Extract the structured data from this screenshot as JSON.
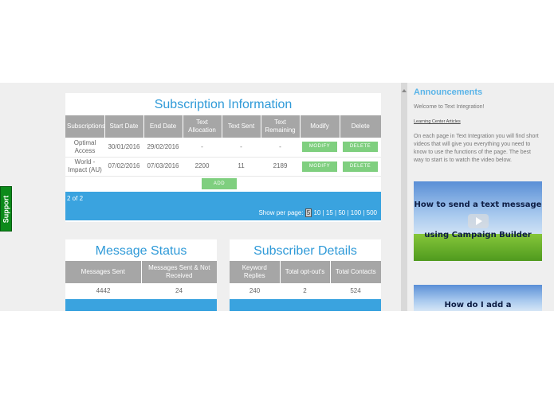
{
  "support_tab": {
    "label": "Support"
  },
  "subscription": {
    "title": "Subscription Information",
    "columns": [
      "Subscriptions",
      "Start Date",
      "End Date",
      "Text Allocation",
      "Text Sent",
      "Text Remaining",
      "Modify",
      "Delete"
    ],
    "rows": [
      {
        "name": "Optimal Access",
        "start": "30/01/2016",
        "end": "29/02/2016",
        "allocation": "-",
        "sent": "-",
        "remaining": "-",
        "modify": "MODIFY",
        "delete": "DELETE"
      },
      {
        "name": "World - Impact (AU)",
        "start": "07/02/2016",
        "end": "07/03/2016",
        "allocation": "2200",
        "sent": "11",
        "remaining": "2189",
        "modify": "MODIFY",
        "delete": "DELETE"
      }
    ],
    "add_label": "ADD",
    "pager_text": "2 of 2",
    "show_per_page_label": "Show per page:",
    "page_sizes": [
      "5",
      "10",
      "15",
      "50",
      "100",
      "500"
    ],
    "selected_page_size": "5"
  },
  "message_status": {
    "title": "Message Status",
    "columns": [
      "Messages Sent",
      "Messages Sent & Not Received"
    ],
    "values": [
      "4442",
      "24"
    ]
  },
  "subscriber_details": {
    "title": "Subscriber Details",
    "columns": [
      "Keyword Replies",
      "Total opt-out's",
      "Total Contacts"
    ],
    "values": [
      "240",
      "2",
      "524"
    ]
  },
  "announcements": {
    "title": "Announcements",
    "welcome": "Welcome to Text Integration!",
    "link": "Learning Center Articles",
    "body": "On each page in Text Integration you will find short videos that will give you everything you need to know to use the functions of the page.  The best way to start is to watch the video below.",
    "video1": {
      "line1": "How to send a text message",
      "line2": "using Campaign Builder"
    },
    "video2": {
      "line1": "How do I add a"
    }
  },
  "colors": {
    "accent": "#2f9ad8",
    "header_gray": "#a6a6a6",
    "button_green": "#7fcf7f",
    "bar_blue": "#3aa3df",
    "support_green": "#0c8a1a"
  }
}
